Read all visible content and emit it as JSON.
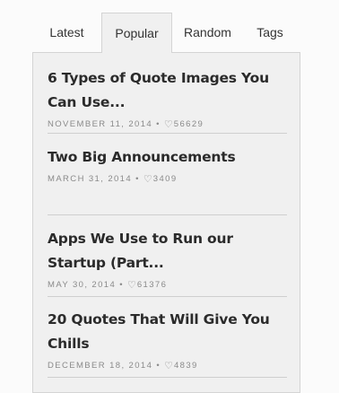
{
  "tabs": [
    {
      "label": "Latest"
    },
    {
      "label": "Popular",
      "active": true
    },
    {
      "label": "Random"
    },
    {
      "label": "Tags"
    }
  ],
  "posts": [
    {
      "title": "6 Types of Quote Images You Can Use...",
      "date": "NOVEMBER 11, 2014",
      "separator": "•",
      "likes": "56629"
    },
    {
      "title": "Two Big Announcements",
      "date": "MARCH 31, 2014",
      "separator": "•",
      "likes": "3409"
    },
    {
      "title": "Apps We Use to Run our Startup (Part...",
      "date": "MAY 30, 2014",
      "separator": "•",
      "likes": "61376"
    },
    {
      "title": "20 Quotes That Will Give You Chills",
      "date": "DECEMBER 18, 2014",
      "separator": "•",
      "likes": "4839"
    }
  ],
  "icons": {
    "likes": "heart-icon"
  },
  "colors": {
    "panel_bg": "#f0f0f0",
    "page_bg": "#fbfbfb",
    "title": "#2b2b2b",
    "meta": "#8a8a8a"
  }
}
